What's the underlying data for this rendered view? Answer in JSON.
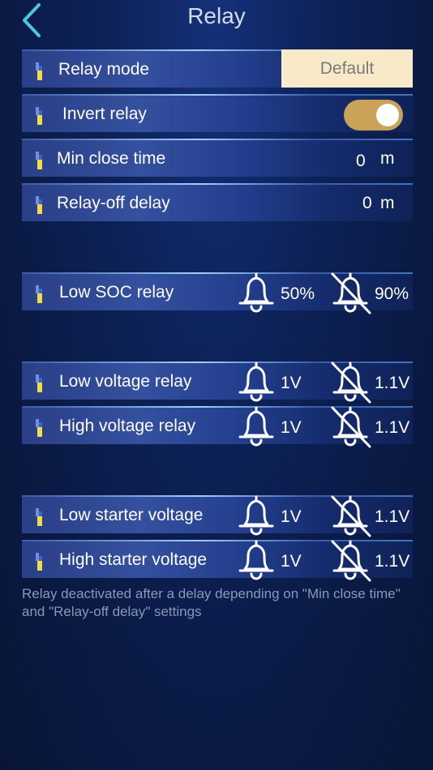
{
  "header": {
    "title": "Relay"
  },
  "relay_mode": {
    "label": "Relay mode",
    "value": "Default"
  },
  "invert_relay": {
    "label": "Invert relay",
    "on": true
  },
  "min_close_time": {
    "label": "Min close time",
    "value": "0",
    "unit": "m"
  },
  "relay_off_delay": {
    "label": "Relay-off delay",
    "value": "0",
    "unit": "m"
  },
  "alarms": [
    {
      "label": "Low SOC relay",
      "on_value": "50%",
      "off_value": "90%"
    },
    {
      "label": "Low voltage relay",
      "on_value": "1V",
      "off_value": "1.1V"
    },
    {
      "label": "High voltage relay",
      "on_value": "1V",
      "off_value": "1.1V"
    },
    {
      "label": "Low starter voltage",
      "on_value": "1V",
      "off_value": "1.1V"
    },
    {
      "label": "High starter voltage",
      "on_value": "1V",
      "off_value": "1.1V"
    }
  ],
  "footnote": "Relay deactivated after a delay depending on \"Min close time\" and \"Relay-off delay\" settings",
  "colors": {
    "accent_toggle": "#c9a357",
    "mode_box": "#f8e9c9",
    "back_arrow": "#4fc3e6"
  },
  "icons": {
    "back": "chevron-left-icon",
    "row": "battery-level-icon",
    "alarm_on": "bell-icon",
    "alarm_off": "bell-off-icon"
  }
}
